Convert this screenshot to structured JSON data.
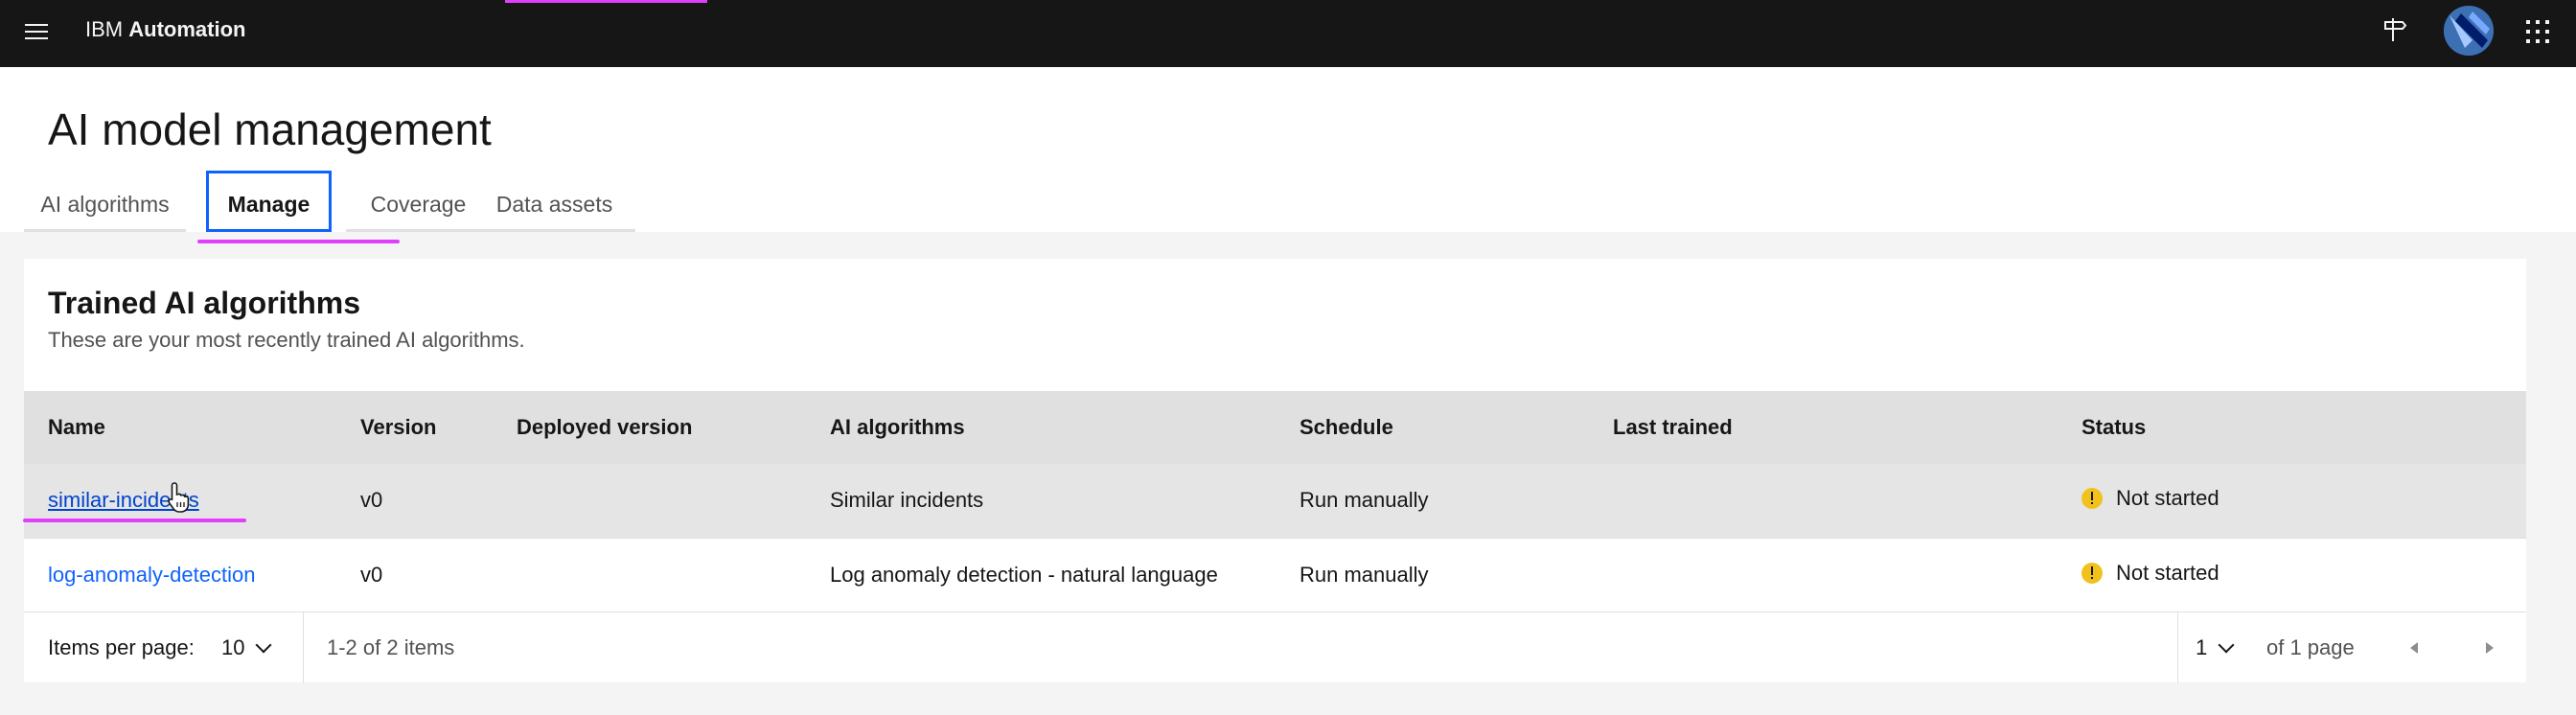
{
  "header": {
    "brand_prefix": "IBM",
    "brand_name": "Automation"
  },
  "page": {
    "title": "AI model management"
  },
  "tabs": [
    {
      "label": "AI algorithms",
      "selected": false
    },
    {
      "label": "Manage",
      "selected": true
    },
    {
      "label": "Coverage",
      "selected": false
    },
    {
      "label": "Data assets",
      "selected": false
    }
  ],
  "card": {
    "title": "Trained AI algorithms",
    "description": "These are your most recently trained AI algorithms."
  },
  "table": {
    "columns": [
      "Name",
      "Version",
      "Deployed version",
      "AI algorithms",
      "Schedule",
      "Last trained",
      "Status"
    ],
    "rows": [
      {
        "name": "similar-incidents",
        "version": "v0",
        "deployed_version": "",
        "ai_algorithms": "Similar incidents",
        "schedule": "Run manually",
        "last_trained": "",
        "status": "Not started"
      },
      {
        "name": "log-anomaly-detection",
        "version": "v0",
        "deployed_version": "",
        "ai_algorithms": "Log anomaly detection - natural language",
        "schedule": "Run manually",
        "last_trained": "",
        "status": "Not started"
      }
    ]
  },
  "pagination": {
    "items_per_page_label": "Items per page:",
    "items_per_page_value": "10",
    "range_text": "1-2 of 2 items",
    "page_value": "1",
    "of_pages_text": "of 1 page"
  },
  "colors": {
    "topbar": "#161616",
    "accent": "#0f62fe",
    "link": "#0f62fe",
    "warning": "#f1c21b",
    "highlight": "#e040fb"
  },
  "icons": [
    "menu-icon",
    "signpost-icon",
    "avatar",
    "app-switcher-icon",
    "warning-icon",
    "chevron-down-icon",
    "caret-left-icon",
    "caret-right-icon",
    "pointer-cursor"
  ]
}
